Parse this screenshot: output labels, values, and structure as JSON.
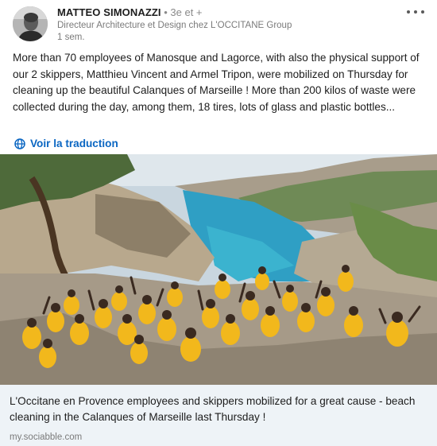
{
  "post": {
    "author": {
      "name": "MATTEO SIMONAZZI",
      "connection": " • 3e et +",
      "headline": "Directeur Architecture et Design chez L'OCCITANE Group",
      "time": "1 sem."
    },
    "text": "More than 70 employees of Manosque and Lagorce, with also the physical support of our 2 skippers, Matthieu Vincent and Armel Tripon, were mobilized on Thursday for cleaning up the beautiful Calanques of Marseille ! More than 200 kilos of waste were collected during the day, among them, 18 tires, lots of glass and plastic bottles...",
    "translate_label": "Voir la traduction",
    "more_icon": "more-horizontal-icon",
    "translate_icon": "globe-icon"
  },
  "link_preview": {
    "title": "L'Occitane en Provence employees and skippers mobilized for a great cause - beach cleaning in the Calanques of Marseille last Thursday !",
    "source": "my.sociabble.com"
  },
  "colors": {
    "link": "#0a66c2",
    "preview_bg": "#eef3f7",
    "shirt_yellow": "#f2b81c"
  }
}
